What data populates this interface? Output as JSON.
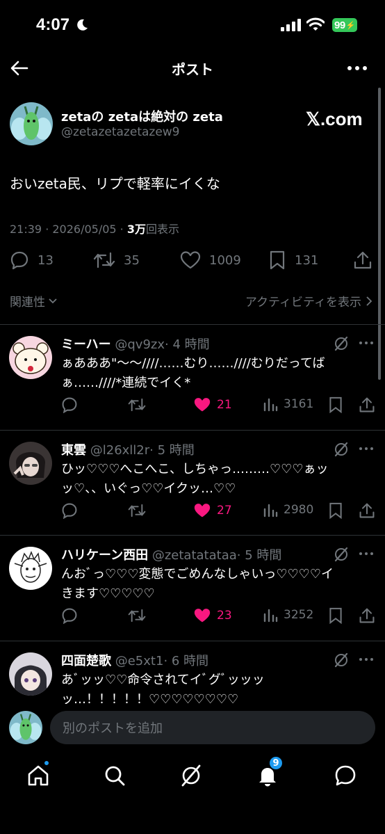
{
  "status_bar": {
    "time": "4:07",
    "battery": "99"
  },
  "header": {
    "title": "ポスト"
  },
  "main_post": {
    "author_name": "zetaの zetaは絶対の zeta",
    "handle": "@zetazetazetazew9",
    "badge": "𝕏.com",
    "text": "おいzeta民、リプで軽率にイくな",
    "timestamp": "21:39 · 2026/05/05 · ",
    "views_count": "3万",
    "views_label": "回表示",
    "replies": "13",
    "reposts": "35",
    "likes": "1009",
    "bookmarks": "131",
    "filter_label": "関連性",
    "activity_label": "アクティビティを表示"
  },
  "replies": [
    {
      "name": "ミーハー",
      "handle": "@qv9zx",
      "time": "· 4 時間",
      "text": "ぁあああ\"〜〜////……むり……////むりだってばぁ……////*連続でイく*",
      "likes": "21",
      "views": "3161"
    },
    {
      "name": "東雲",
      "handle": "@l26xll2r",
      "time": "· 5 時間",
      "text": "ひッ♡♡♡へこへこ、しちゃっ………♡♡♡ぁッッ♡、、いぐっ♡♡イクッ…♡♡",
      "likes": "27",
      "views": "2980"
    },
    {
      "name": "ハリケーン西田",
      "handle": "@zetatatataa",
      "time": "· 5 時間",
      "text": "んおﾞっ♡♡♡変態でごめんなしゃいっ♡♡♡♡イきます♡♡♡♡♡",
      "likes": "23",
      "views": "3252"
    },
    {
      "name": "四面楚歌",
      "handle": "@e5xt1",
      "time": "· 6 時間",
      "text": "あﾞッッ♡♡命令されてイﾞグﾞッッッッ…！！！！！♡♡♡♡♡♡♡♡",
      "likes": "",
      "views": ""
    }
  ],
  "composer": {
    "placeholder": "別のポストを追加"
  },
  "bottom_nav": {
    "notifications_badge": "9"
  },
  "colors": {
    "like": "#f91880",
    "accent": "#1d9bf0",
    "muted": "#71767b",
    "battery": "#34c759"
  }
}
